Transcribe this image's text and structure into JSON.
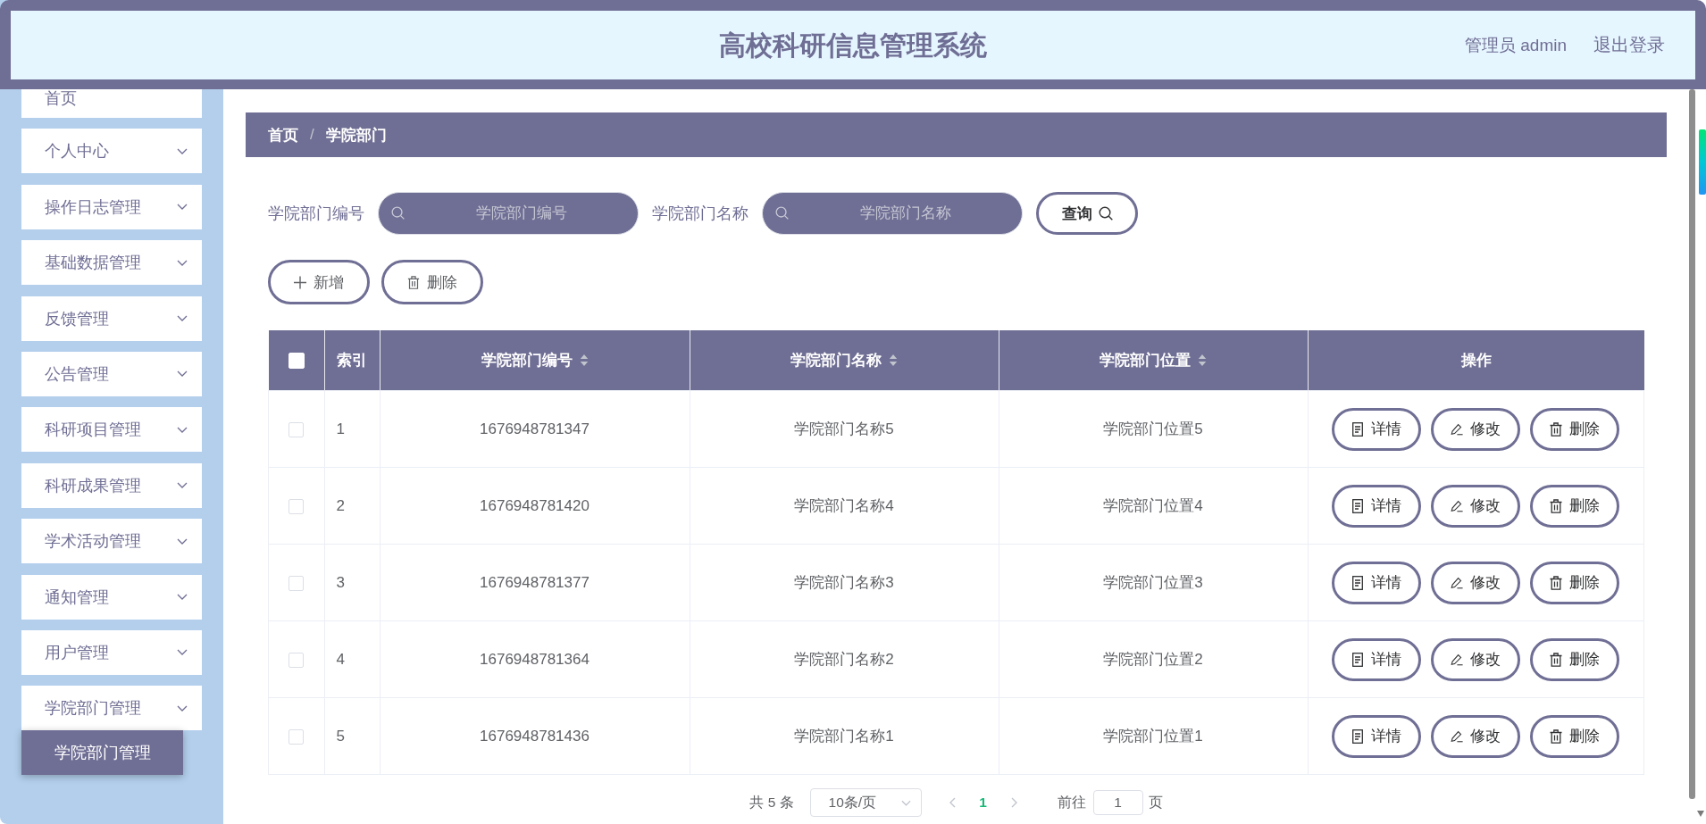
{
  "header": {
    "title": "高校科研信息管理系统",
    "user": "管理员 admin",
    "logout": "退出登录"
  },
  "sidebar": {
    "items": [
      {
        "label": "首页",
        "kind": "link"
      },
      {
        "label": "个人中心",
        "kind": "submenu"
      },
      {
        "label": "操作日志管理",
        "kind": "submenu"
      },
      {
        "label": "基础数据管理",
        "kind": "submenu"
      },
      {
        "label": "反馈管理",
        "kind": "submenu"
      },
      {
        "label": "公告管理",
        "kind": "submenu"
      },
      {
        "label": "科研项目管理",
        "kind": "submenu"
      },
      {
        "label": "科研成果管理",
        "kind": "submenu"
      },
      {
        "label": "学术活动管理",
        "kind": "submenu"
      },
      {
        "label": "通知管理",
        "kind": "submenu"
      },
      {
        "label": "用户管理",
        "kind": "submenu"
      },
      {
        "label": "学院部门管理",
        "kind": "submenu",
        "children": [
          {
            "label": "学院部门管理",
            "selected": true
          }
        ]
      }
    ]
  },
  "breadcrumb": {
    "items": [
      "首页",
      "学院部门"
    ],
    "separator": "/"
  },
  "search": {
    "fields": [
      {
        "label": "学院部门编号",
        "placeholder": "学院部门编号"
      },
      {
        "label": "学院部门名称",
        "placeholder": "学院部门名称"
      }
    ],
    "button": "查询"
  },
  "toolbar": [
    {
      "label": "新增",
      "kind": "add"
    },
    {
      "label": "删除",
      "kind": "delete"
    }
  ],
  "table": {
    "select_all_checked": false,
    "columns": [
      {
        "label": "索引",
        "sortable": false
      },
      {
        "label": "学院部门编号",
        "sortable": true
      },
      {
        "label": "学院部门名称",
        "sortable": true
      },
      {
        "label": "学院部门位置",
        "sortable": true
      },
      {
        "label": "操作",
        "sortable": false
      }
    ],
    "rows": [
      {
        "checked": false,
        "cells": [
          "1",
          "1676948781347",
          "学院部门名称5",
          "学院部门位置5"
        ],
        "actions": [
          {
            "label": "详情",
            "kind": "detail"
          },
          {
            "label": "修改",
            "kind": "edit"
          },
          {
            "label": "删除",
            "kind": "delete"
          }
        ]
      },
      {
        "checked": false,
        "cells": [
          "2",
          "1676948781420",
          "学院部门名称4",
          "学院部门位置4"
        ],
        "actions": [
          {
            "label": "详情",
            "kind": "detail"
          },
          {
            "label": "修改",
            "kind": "edit"
          },
          {
            "label": "删除",
            "kind": "delete"
          }
        ]
      },
      {
        "checked": false,
        "cells": [
          "3",
          "1676948781377",
          "学院部门名称3",
          "学院部门位置3"
        ],
        "actions": [
          {
            "label": "详情",
            "kind": "detail"
          },
          {
            "label": "修改",
            "kind": "edit"
          },
          {
            "label": "删除",
            "kind": "delete"
          }
        ]
      },
      {
        "checked": false,
        "cells": [
          "4",
          "1676948781364",
          "学院部门名称2",
          "学院部门位置2"
        ],
        "actions": [
          {
            "label": "详情",
            "kind": "detail"
          },
          {
            "label": "修改",
            "kind": "edit"
          },
          {
            "label": "删除",
            "kind": "delete"
          }
        ]
      },
      {
        "checked": false,
        "cells": [
          "5",
          "1676948781436",
          "学院部门名称1",
          "学院部门位置1"
        ],
        "actions": [
          {
            "label": "详情",
            "kind": "detail"
          },
          {
            "label": "修改",
            "kind": "edit"
          },
          {
            "label": "删除",
            "kind": "delete"
          }
        ]
      }
    ]
  },
  "pagination": {
    "total": "共 5 条",
    "page_size": "10条/页",
    "prev_disabled": true,
    "pages": [
      {
        "label": "1",
        "selected": true
      }
    ],
    "next_disabled": true,
    "goto_label": "前往",
    "goto_value": "1",
    "page_suffix": "页"
  }
}
